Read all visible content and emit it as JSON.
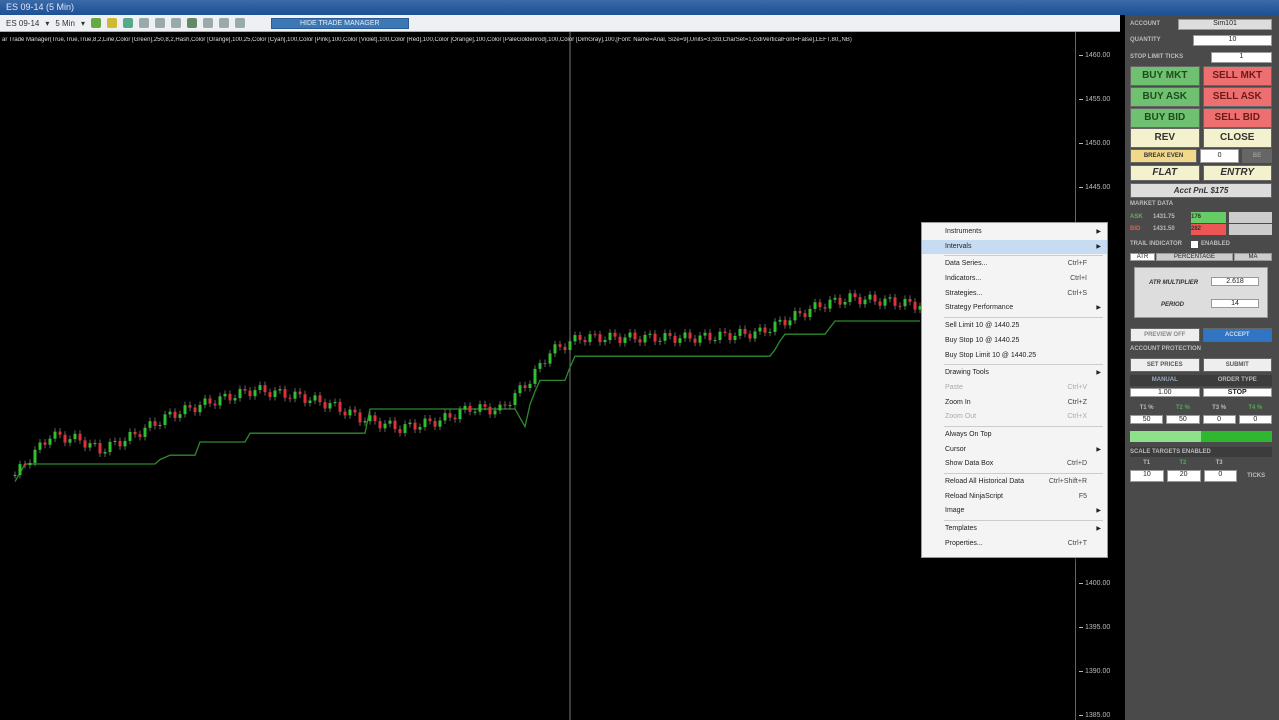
{
  "window": {
    "title": "ES 09-14 (5 Min)"
  },
  "toolbar": {
    "instrument": "ES 09-14",
    "interval": "5 Min",
    "hide_button": "HIDE TRADE MANAGER"
  },
  "chart": {
    "indicator_label": "ar Trade Manager(True,True,True,8,2,Line,Color [Green],250,8,2,Hash,Color [Orange],100,25,Color [Cyan],100,Color [Pink],100,Color [Violet],100,Color [Red],100,Color [Orange],100,Color [PaleGoldenrod],100,Color [DimGray],100,[Font: Name=Arial, Size=9],Units=3,Std,CharSet=1,GdiVerticalFont=False],LEFT,80,,NB)"
  },
  "chart_data": {
    "type": "candlestick",
    "ylim": [
      1383,
      1462
    ],
    "yticks": [
      "1460.00",
      "1455.00",
      "1450.00",
      "1445.00",
      "1400.00",
      "1395.00",
      "1390.00",
      "1385.00"
    ],
    "ytick_values": [
      1460,
      1455,
      1450,
      1445,
      1400,
      1395,
      1390,
      1385
    ],
    "bar_count": 182,
    "close_keyframes": [
      [
        0,
        1412.5
      ],
      [
        7,
        1417.0
      ],
      [
        13,
        1416.5
      ],
      [
        17,
        1415.3
      ],
      [
        23,
        1416.8
      ],
      [
        31,
        1419.3
      ],
      [
        39,
        1420.8
      ],
      [
        48,
        1422.2
      ],
      [
        57,
        1421.4
      ],
      [
        63,
        1420.5
      ],
      [
        69,
        1419.0
      ],
      [
        77,
        1417.8
      ],
      [
        85,
        1418.7
      ],
      [
        91,
        1420.1
      ],
      [
        97,
        1419.9
      ],
      [
        103,
        1423.3
      ],
      [
        107,
        1426.5
      ],
      [
        113,
        1428.1
      ],
      [
        121,
        1428.1
      ],
      [
        137,
        1428.1
      ],
      [
        149,
        1428.7
      ],
      [
        155,
        1430.3
      ],
      [
        161,
        1431.8
      ],
      [
        167,
        1432.6
      ],
      [
        175,
        1432.2
      ],
      [
        181,
        1431.8
      ]
    ],
    "stop_keyframes": [
      [
        0,
        1411.8
      ],
      [
        2,
        1413.8
      ],
      [
        28,
        1413.8
      ],
      [
        31,
        1414.8
      ],
      [
        36,
        1414.8
      ],
      [
        37,
        1416.3
      ],
      [
        46,
        1416.3
      ],
      [
        47,
        1417.3
      ],
      [
        70,
        1417.3
      ],
      [
        71,
        1420.0
      ],
      [
        100,
        1420.0
      ],
      [
        102,
        1418.0
      ],
      [
        103,
        1420.5
      ],
      [
        105,
        1423.3
      ],
      [
        110,
        1423.3
      ],
      [
        112,
        1426.0
      ],
      [
        151,
        1426.0
      ],
      [
        154,
        1428.5
      ],
      [
        162,
        1428.5
      ],
      [
        164,
        1430.0
      ],
      [
        181,
        1430.0
      ]
    ],
    "crosshair_bar": 111
  },
  "menu": {
    "items": [
      {
        "label": "Instruments",
        "arrow": true
      },
      {
        "label": "Intervals",
        "arrow": true,
        "hl": true
      },
      {
        "sep": true
      },
      {
        "label": "Data Series...",
        "sc": "Ctrl+F"
      },
      {
        "label": "Indicators...",
        "sc": "Ctrl+I"
      },
      {
        "label": "Strategies...",
        "sc": "Ctrl+S"
      },
      {
        "label": "Strategy Performance",
        "arrow": true
      },
      {
        "sep": true
      },
      {
        "label": "Sell Limit 10 @ 1440.25"
      },
      {
        "label": "Buy Stop 10 @ 1440.25"
      },
      {
        "label": "Buy Stop Limit 10 @ 1440.25"
      },
      {
        "sep": true
      },
      {
        "label": "Drawing Tools",
        "arrow": true
      },
      {
        "label": "Paste",
        "sc": "Ctrl+V",
        "dis": true
      },
      {
        "label": "Zoom In",
        "sc": "Ctrl+Z"
      },
      {
        "label": "Zoom Out",
        "sc": "Ctrl+X",
        "dis": true
      },
      {
        "sep": true
      },
      {
        "label": "Always On Top"
      },
      {
        "label": "Cursor",
        "arrow": true
      },
      {
        "label": "Show Data Box",
        "sc": "Ctrl+D"
      },
      {
        "sep": true
      },
      {
        "label": "Reload All Historical Data",
        "sc": "Ctrl+Shift+R"
      },
      {
        "label": "Reload NinjaScript",
        "sc": "F5"
      },
      {
        "label": "Image",
        "arrow": true
      },
      {
        "sep": true
      },
      {
        "label": "Templates",
        "arrow": true
      },
      {
        "label": "Properties...",
        "sc": "Ctrl+T"
      }
    ]
  },
  "panel": {
    "account_label": "ACCOUNT",
    "account": "Sim101",
    "quantity_label": "QUANTITY",
    "quantity": "10",
    "stop_limit_label": "STOP LIMIT TICKS",
    "stop_limit": "1",
    "buy_mkt": "BUY MKT",
    "sell_mkt": "SELL MKT",
    "buy_ask": "BUY ASK",
    "sell_ask": "SELL ASK",
    "buy_bid": "BUY BID",
    "sell_bid": "SELL BID",
    "rev": "REV",
    "close": "CLOSE",
    "break_even": "BREAK EVEN",
    "be_ticks": "0",
    "be_btn": "BE",
    "flat": "FLAT",
    "entry": "ENTRY",
    "pnl": "Acct PnL $175",
    "market_data": "MARKET DATA",
    "ask_label": "ASK",
    "ask": "1431.75",
    "ask_size": "176",
    "bid_label": "BID",
    "bid": "1431.50",
    "bid_size": "282",
    "trail_label": "TRAIL INDICATOR",
    "enabled_label": "ENABLED",
    "tabs": [
      "ATR",
      "PERCENTAGE",
      "MA"
    ],
    "atr_mult_label": "ATR MULTIPLIER",
    "atr_mult": "2.618",
    "period_label": "PERIOD",
    "period": "14",
    "preview": "PREVIEW OFF",
    "accept": "ACCEPT",
    "protection": "ACCOUNT PROTECTION",
    "set_prices": "SET PRICES",
    "submit": "SUBMIT",
    "manual": "MANUAL",
    "order_type_label": "ORDER TYPE",
    "manual_val": "1.00",
    "order_type": "STOP",
    "t1_label": "T1 %",
    "t2_label": "T2 %",
    "t3_label": "T3 %",
    "t4_label": "T4 %",
    "t1": "50",
    "t2": "50",
    "t3": "0",
    "t4": "0",
    "scale_label": "SCALE TARGETS ENABLED",
    "s1_label": "T1",
    "s2_label": "T2",
    "s3_label": "T3",
    "s1": "10",
    "s2": "20",
    "s3": "0",
    "ticks": "TICKS",
    "colors": {
      "buy": "#6fc070",
      "sell": "#ee6f6f",
      "accept": "#2f75c4"
    }
  }
}
